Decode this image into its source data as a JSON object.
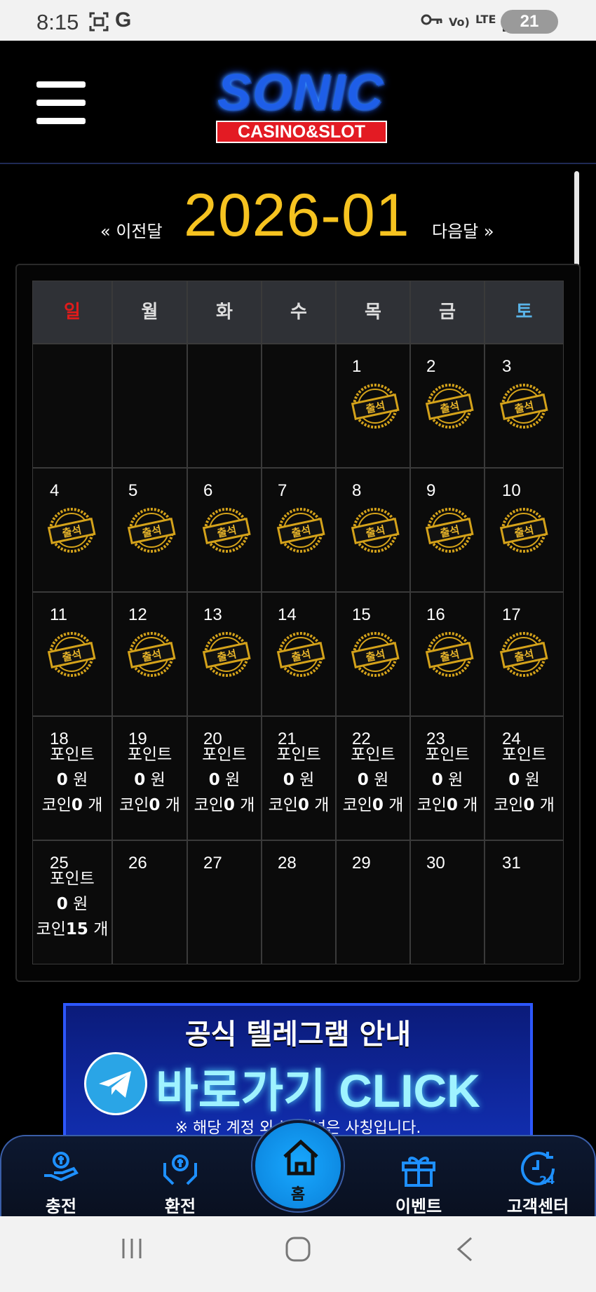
{
  "status_bar": {
    "time": "8:15",
    "icons": [
      "screenshot-icon",
      "google-icon",
      "vpn-key-icon",
      "volte-icon",
      "lte-icon",
      "signal-icon"
    ],
    "volte": "Vo)",
    "lte": "LTE",
    "battery": "21"
  },
  "header": {
    "logo_title": "SONIC",
    "logo_subtitle": "CASINO&SLOT"
  },
  "calendar": {
    "prev_label": "« 이전달",
    "next_label": "다음달 »",
    "month": "2026-01",
    "weekdays": [
      "일",
      "월",
      "화",
      "수",
      "목",
      "금",
      "토"
    ],
    "weeks": [
      [
        {
          "day": ""
        },
        {
          "day": ""
        },
        {
          "day": ""
        },
        {
          "day": ""
        },
        {
          "day": "1",
          "stamp": true
        },
        {
          "day": "2",
          "stamp": true
        },
        {
          "day": "3",
          "stamp": true
        }
      ],
      [
        {
          "day": "4",
          "stamp": true
        },
        {
          "day": "5",
          "stamp": true
        },
        {
          "day": "6",
          "stamp": true
        },
        {
          "day": "7",
          "stamp": true
        },
        {
          "day": "8",
          "stamp": true
        },
        {
          "day": "9",
          "stamp": true
        },
        {
          "day": "10",
          "stamp": true
        }
      ],
      [
        {
          "day": "11",
          "stamp": true
        },
        {
          "day": "12",
          "stamp": true
        },
        {
          "day": "13",
          "stamp": true
        },
        {
          "day": "14",
          "stamp": true
        },
        {
          "day": "15",
          "stamp": true
        },
        {
          "day": "16",
          "stamp": true
        },
        {
          "day": "17",
          "stamp": true
        }
      ],
      [
        {
          "day": "18",
          "points": "0",
          "coins": "0"
        },
        {
          "day": "19",
          "points": "0",
          "coins": "0"
        },
        {
          "day": "20",
          "points": "0",
          "coins": "0"
        },
        {
          "day": "21",
          "points": "0",
          "coins": "0"
        },
        {
          "day": "22",
          "points": "0",
          "coins": "0"
        },
        {
          "day": "23",
          "points": "0",
          "coins": "0"
        },
        {
          "day": "24",
          "points": "0",
          "coins": "0"
        }
      ],
      [
        {
          "day": "25",
          "points": "0",
          "coins": "15"
        },
        {
          "day": "26"
        },
        {
          "day": "27"
        },
        {
          "day": "28"
        },
        {
          "day": "29"
        },
        {
          "day": "30"
        },
        {
          "day": "31"
        }
      ]
    ],
    "stamp_text": "출석",
    "points_label": "포인트",
    "won_unit": "원",
    "coin_label": "코인",
    "coin_unit": "개"
  },
  "banner": {
    "title": "공식 텔레그램 안내",
    "cta": "바로가기 CLICK",
    "note": "※ 해당 계정 외 본 채널은 사칭입니다."
  },
  "bottom_nav": {
    "items": [
      {
        "label": "충전",
        "icon": "deposit-icon"
      },
      {
        "label": "환전",
        "icon": "withdraw-icon"
      },
      {
        "label": "홈",
        "icon": "home-icon"
      },
      {
        "label": "이벤트",
        "icon": "gift-icon"
      },
      {
        "label": "고객센터",
        "icon": "support-24-icon"
      }
    ]
  },
  "colors": {
    "month_title": "#f6c320",
    "sunday": "#e01b1b",
    "saturday": "#5ab4e8",
    "nav_accent": "#1e90ff"
  }
}
